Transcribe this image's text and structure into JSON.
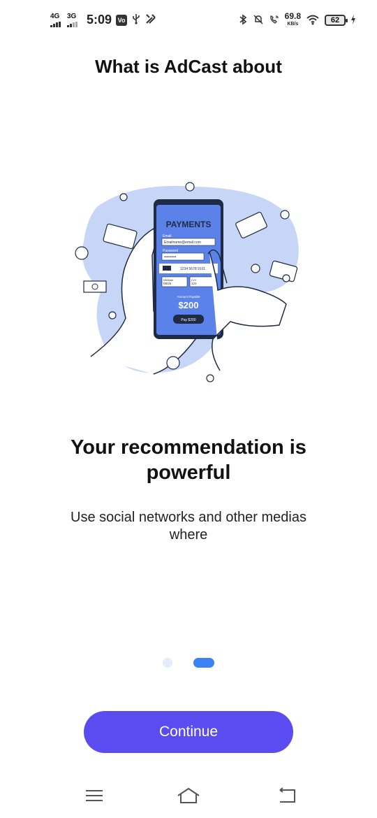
{
  "status_bar": {
    "network1": "4G",
    "network2": "3G",
    "time": "5:09",
    "notif_box": "Vo",
    "speed_value": "69.8",
    "speed_unit": "KB/s",
    "battery": "62"
  },
  "header": {
    "title": "What is AdCast about"
  },
  "illustration": {
    "phone_title": "PAYMENTS",
    "email_label": "Email",
    "email_value": "Emailname@email.com",
    "password_label": "Password",
    "password_value": "••••••••••",
    "card_number": "1234 5678 9101",
    "expiry_label": "MM/Date",
    "expiry_value": "08/25",
    "cvv_label": "CVV",
    "cvv_value": "123",
    "amount_label": "Amount Payable",
    "amount_value": "$200",
    "pay_button": "Pay $200",
    "icons": [
      "dollar-coin-icon",
      "credit-card-icon",
      "banknote-icon",
      "hand-icon"
    ],
    "colors": {
      "blob": "#c7d6f7",
      "phone_screen": "#5b82e8",
      "outline": "#1f2a44"
    }
  },
  "slide": {
    "title": "Your recommendation is powerful",
    "description": "Use social networks and other medias where"
  },
  "pager": {
    "page_count": 2,
    "active_index": 1,
    "colors": {
      "inactive": "#e6ebfa",
      "active": "#3b82f6"
    }
  },
  "actions": {
    "continue_label": "Continue",
    "color": "#5b4cf0"
  },
  "nav_bar": {
    "icons": [
      "menu-icon",
      "home-icon",
      "back-icon"
    ]
  }
}
